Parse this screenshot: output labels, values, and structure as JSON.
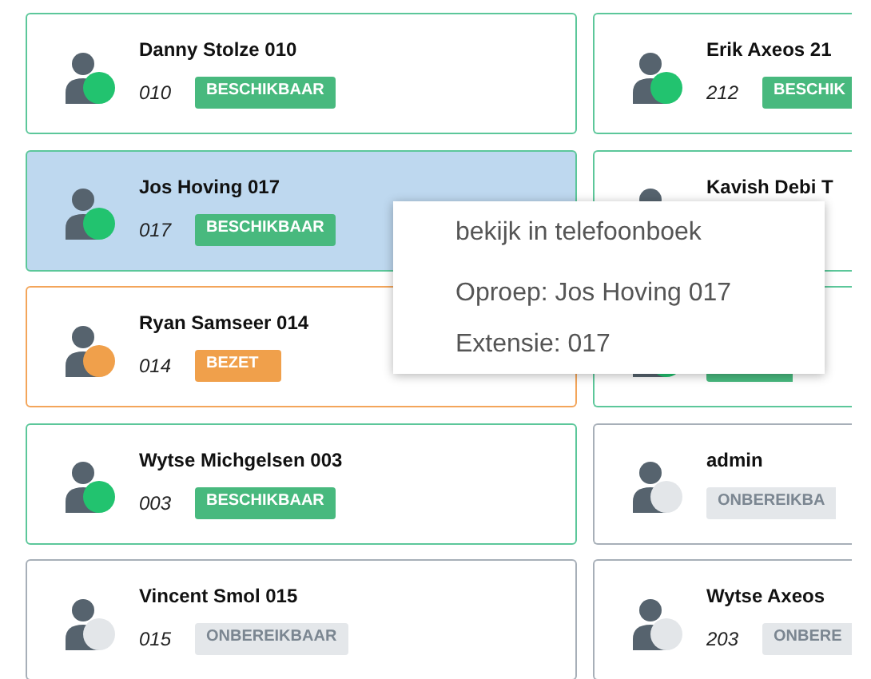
{
  "contacts": [
    {
      "name": "Danny Stolze 010",
      "extension": "010",
      "status": "BESCHIKBAAR",
      "kind": "available",
      "selected": false
    },
    {
      "name": "Erik Axeos 21",
      "extension": "212",
      "status": "BESCHIK",
      "kind": "available",
      "selected": false
    },
    {
      "name": "Jos Hoving 017",
      "extension": "017",
      "status": "BESCHIKBAAR",
      "kind": "available",
      "selected": true
    },
    {
      "name": "Kavish Debi T",
      "kind": "available",
      "selected": false
    },
    {
      "name": "Ryan Samseer 014",
      "extension": "014",
      "status": "BEZET",
      "kind": "busy",
      "selected": false
    },
    {
      "kind": "available",
      "selected": false
    },
    {
      "name": "Wytse Michgelsen 003",
      "extension": "003",
      "status": "BESCHIKBAAR",
      "kind": "available",
      "selected": false
    },
    {
      "name": "admin",
      "status": "ONBEREIKBA",
      "kind": "offline",
      "selected": false
    },
    {
      "name": "Vincent Smol 015",
      "extension": "015",
      "status": "ONBEREIKBAAR",
      "kind": "offline",
      "selected": false
    },
    {
      "name": "Wytse Axeos",
      "extension": "203",
      "status": "ONBERE",
      "kind": "offline",
      "selected": false
    }
  ],
  "context_menu": {
    "items": [
      "bekijk in telefoonboek",
      "Oproep: Jos Hoving 017",
      "Extensie: 017"
    ]
  }
}
